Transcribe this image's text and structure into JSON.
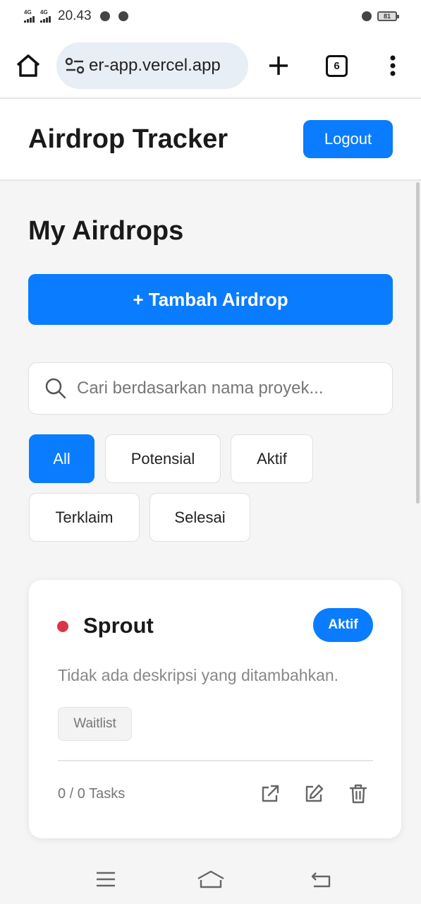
{
  "status_bar": {
    "network_1": "4G",
    "network_2": "4G",
    "time": "20.43",
    "battery": "81"
  },
  "browser": {
    "url": "er-app.vercel.app",
    "tab_count": "6"
  },
  "header": {
    "title": "Airdrop Tracker",
    "logout_label": "Logout"
  },
  "main": {
    "page_title": "My Airdrops",
    "add_button_label": "+ Tambah Airdrop",
    "search_placeholder": "Cari berdasarkan nama proyek...",
    "filters": [
      {
        "label": "All",
        "active": true
      },
      {
        "label": "Potensial",
        "active": false
      },
      {
        "label": "Aktif",
        "active": false
      },
      {
        "label": "Terklaim",
        "active": false
      },
      {
        "label": "Selesai",
        "active": false
      }
    ]
  },
  "card": {
    "name": "Sprout",
    "status": "Aktif",
    "description": "Tidak ada deskripsi yang ditambahkan.",
    "tag": "Waitlist",
    "tasks": "0 / 0 Tasks",
    "status_dot_color": "#dc3545"
  },
  "colors": {
    "accent": "#0a7cff"
  },
  "icons": {
    "home": "home-icon",
    "site_settings": "tune-icon",
    "new_tab": "plus-icon",
    "menu": "more-vert-icon",
    "search": "search-icon",
    "open": "external-link-icon",
    "edit": "edit-icon",
    "delete": "trash-icon",
    "nav_menu": "menu-icon",
    "nav_home": "home-outline-icon",
    "nav_back": "back-icon"
  }
}
